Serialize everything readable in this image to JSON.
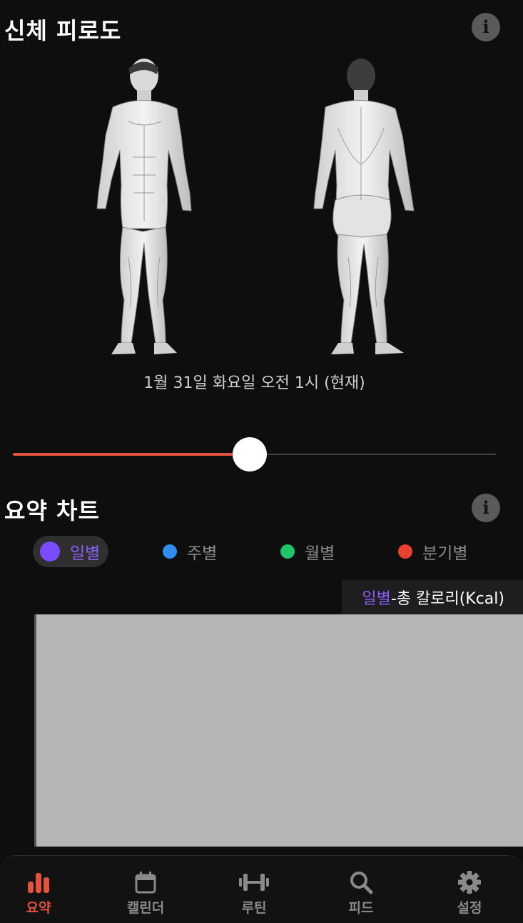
{
  "body_map": {
    "title": "신체 피로도",
    "datetime": "1월 31일 화요일 오전 1시 (현재)",
    "slider": {
      "position_fraction": 0.49,
      "fill_color": "#e2533e"
    }
  },
  "summary": {
    "title": "요약 차트",
    "tabs": [
      {
        "label": "일별",
        "color": "#7a4cff",
        "active": true
      },
      {
        "label": "주별",
        "color": "#2f8cf0",
        "active": false
      },
      {
        "label": "월별",
        "color": "#1fc46a",
        "active": false
      },
      {
        "label": "분기별",
        "color": "#e8412f",
        "active": false
      }
    ],
    "chart_header": {
      "period": "일별",
      "metric": "-총 칼로리(Kcal)"
    }
  },
  "nav": {
    "items": [
      {
        "label": "요약",
        "icon": "bar-chart-icon",
        "active": true
      },
      {
        "label": "캘린더",
        "icon": "calendar-icon",
        "active": false
      },
      {
        "label": "루틴",
        "icon": "dumbbell-icon",
        "active": false
      },
      {
        "label": "피드",
        "icon": "search-icon",
        "active": false
      },
      {
        "label": "설정",
        "icon": "gear-icon",
        "active": false
      }
    ]
  },
  "colors": {
    "accent": "#e2533e",
    "daily_accent": "#8a5cff"
  }
}
